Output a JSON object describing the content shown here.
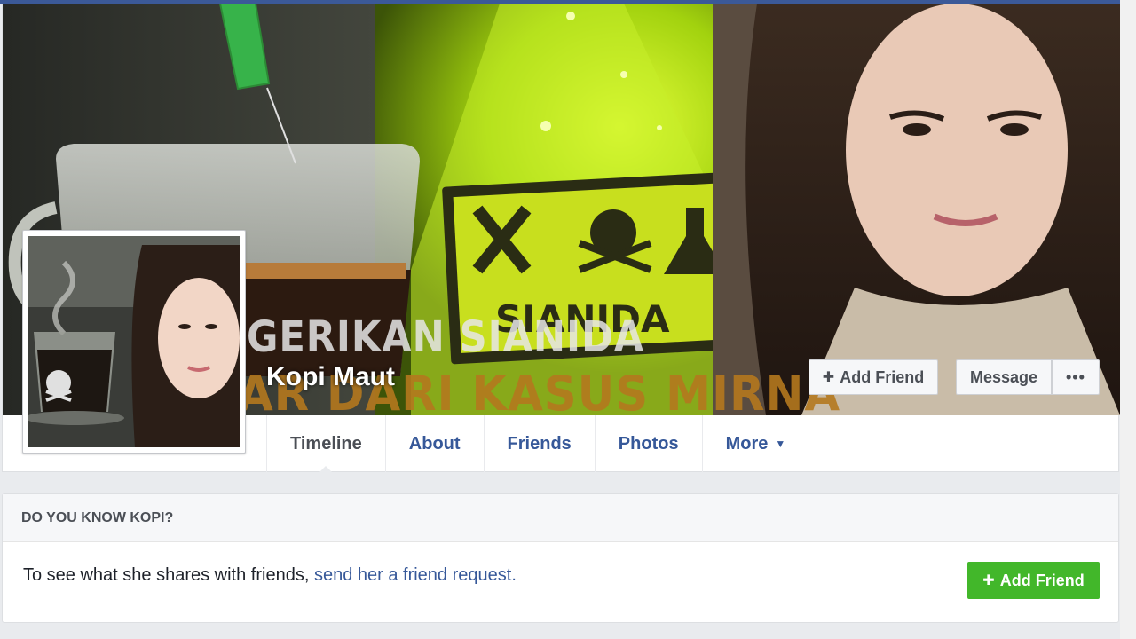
{
  "profile": {
    "name": "Kopi Maut"
  },
  "cover": {
    "headline_top": "GERIKAN SIANIDA",
    "headline_bottom": "AR DARI KASUS MIRNA",
    "sign_text": "SIANIDA",
    "actions": {
      "add_friend_label": "Add Friend",
      "message_label": "Message",
      "more_label": "•••"
    }
  },
  "tabs": [
    {
      "label": "Timeline"
    },
    {
      "label": "About"
    },
    {
      "label": "Friends"
    },
    {
      "label": "Photos"
    },
    {
      "label": "More"
    }
  ],
  "know_card": {
    "title": "DO YOU KNOW KOPI?",
    "body_text": "To see what she shares with friends, ",
    "link_text": "send her a friend request.",
    "add_friend_label": "Add Friend"
  },
  "colors": {
    "brand_blue": "#3b5998",
    "link_blue": "#365899",
    "add_friend_green": "#42b72a",
    "toxic_green": "#b8e010"
  },
  "icons": {
    "add_friend": "person-plus-icon",
    "dropdown": "caret-down-icon",
    "more": "ellipsis-icon"
  }
}
